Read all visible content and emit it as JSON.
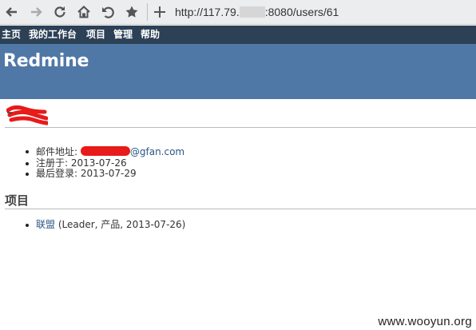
{
  "browser": {
    "url_prefix": "http://117.79.",
    "url_suffix": ":8080/users/61",
    "icons": [
      "back-arrow-icon",
      "forward-arrow-icon",
      "reload-icon",
      "home-icon",
      "undo-icon",
      "star-icon",
      "new-tab-plus-icon"
    ]
  },
  "top_menu": {
    "items": [
      "主页",
      "我的工作台",
      "项目",
      "管理",
      "帮助"
    ]
  },
  "header": {
    "title": "Redmine",
    "background": "#4f78a6"
  },
  "user": {
    "info": {
      "email_label": "邮件地址:",
      "email_domain": "@gfan.com",
      "registered": "注册于: 2013-07-26",
      "last_login": "最后登录: 2013-07-29"
    }
  },
  "projects": {
    "heading": "项目",
    "items": [
      {
        "name": "联盟",
        "detail": "(Leader, 产品, 2013-07-26)"
      }
    ]
  },
  "watermark": "www.wooyun.org",
  "colors": {
    "top_menu_bg": "#2c4056",
    "link": "#2a5685",
    "redaction": "#e81a1a"
  }
}
